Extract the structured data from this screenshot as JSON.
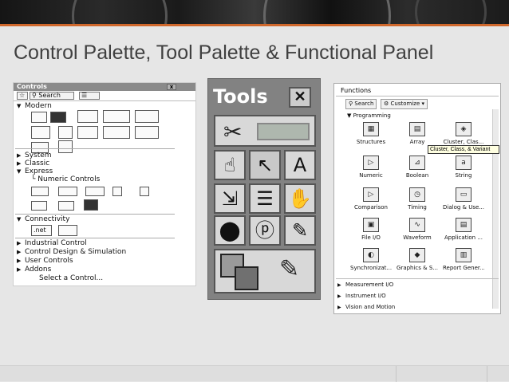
{
  "slide": {
    "title": "Control Palette, Tool Palette & Functional Panel"
  },
  "controls": {
    "title": "Controls",
    "search_label": "Search",
    "categories": [
      {
        "label": "Modern",
        "expanded": true
      },
      {
        "label": "System",
        "expanded": false
      },
      {
        "label": "Classic",
        "expanded": false
      },
      {
        "label": "Express",
        "expanded": true
      },
      {
        "label": "Numeric Controls",
        "expanded": false
      },
      {
        "label": "Connectivity",
        "expanded": true
      },
      {
        "label": "Industrial Control",
        "expanded": false
      },
      {
        "label": "Control Design & Simulation",
        "expanded": false
      },
      {
        "label": "User Controls",
        "expanded": false
      },
      {
        "label": "Addons",
        "expanded": false
      }
    ],
    "select_control": "Select a Control...",
    "net_label": ".net"
  },
  "tools": {
    "title": "Tools",
    "close": "✕",
    "items": [
      {
        "name": "operate-value",
        "glyph": "☝"
      },
      {
        "name": "position-select",
        "glyph": "↖"
      },
      {
        "name": "edit-text",
        "glyph": "A"
      },
      {
        "name": "connect-wire",
        "glyph": "⇲"
      },
      {
        "name": "object-shortcut-menu",
        "glyph": "☰"
      },
      {
        "name": "scroll-window",
        "glyph": "✋"
      },
      {
        "name": "breakpoint",
        "glyph": "⬤"
      },
      {
        "name": "probe",
        "glyph": "ⓟ"
      },
      {
        "name": "get-color",
        "glyph": "✎"
      }
    ]
  },
  "functions": {
    "title": "Functions",
    "search_label": "Search",
    "customize_label": "Customize",
    "section": "Programming",
    "tiles": [
      {
        "label": "Structures",
        "glyph": "▦"
      },
      {
        "label": "Array",
        "glyph": "▤"
      },
      {
        "label": "Cluster, Clas...",
        "glyph": "◈"
      },
      {
        "label": "Numeric",
        "glyph": "▷"
      },
      {
        "label": "Boolean",
        "glyph": "⊿"
      },
      {
        "label": "String",
        "glyph": "a"
      },
      {
        "label": "Comparison",
        "glyph": "▷"
      },
      {
        "label": "Timing",
        "glyph": "◷"
      },
      {
        "label": "Dialog & Use...",
        "glyph": "▭"
      },
      {
        "label": "File I/O",
        "glyph": "▣"
      },
      {
        "label": "Waveform",
        "glyph": "∿"
      },
      {
        "label": "Application ...",
        "glyph": "▤"
      },
      {
        "label": "Synchronizat...",
        "glyph": "◐"
      },
      {
        "label": "Graphics & S...",
        "glyph": "◆"
      },
      {
        "label": "Report Gener...",
        "glyph": "▥"
      }
    ],
    "tooltip": "Cluster, Class, & Variant",
    "subpalettes": [
      "Measurement I/O",
      "Instrument I/O",
      "Vision and Motion"
    ]
  }
}
